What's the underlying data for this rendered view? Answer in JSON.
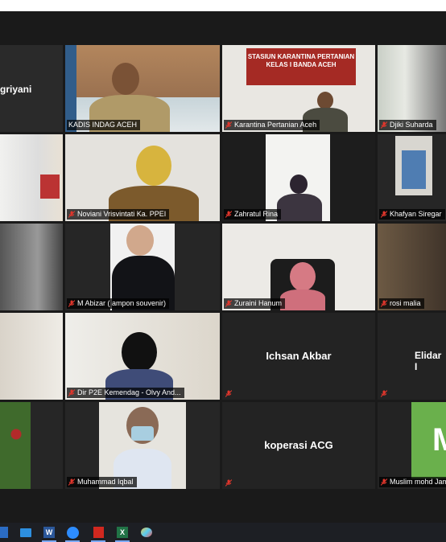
{
  "window": {
    "title": ""
  },
  "gallery": {
    "partial_name_left": "griyani",
    "tiles": [
      {
        "name": "KADIS INDAG ACEH"
      },
      {
        "name": "Karantina Pertanian Aceh",
        "banner": "STASIUN KARANTINA PERTANIAN\nKELAS I BANDA ACEH"
      },
      {
        "name": "Djiki Suharda"
      },
      {
        "name": "Noviani Vrisvintati Ka. PPEI"
      },
      {
        "name": "Zahratul Rina"
      },
      {
        "name": "Khafyan Siregar"
      },
      {
        "name": "M Abizar ( ampon souvenir)"
      },
      {
        "name": "Zuraini Hanum"
      },
      {
        "name": "rosi malia"
      },
      {
        "name": "Dir P2E Kemendag - Olvy And...",
        "big": "Ichsan Akbar"
      },
      {
        "name": "",
        "big": "Ichsan Akbar"
      },
      {
        "name": "",
        "big": "Elidar I"
      },
      {
        "name": "Muhammad Iqbal"
      },
      {
        "name": "",
        "big": "koperasi ACG"
      },
      {
        "name": "Muslim mohd Jamil",
        "big_letter": "M"
      }
    ]
  },
  "colors": {
    "active_border": "#c7e64a",
    "mute_red": "#e0362c",
    "tile_bg": "#232323",
    "stage_bg": "#1a1a1a",
    "green_tile": "#6ab04c"
  },
  "taskbar": {
    "icons": [
      "app-icon",
      "mail-icon",
      "word-icon",
      "zoom-icon",
      "pdf-icon",
      "excel-icon",
      "paint-icon"
    ]
  }
}
